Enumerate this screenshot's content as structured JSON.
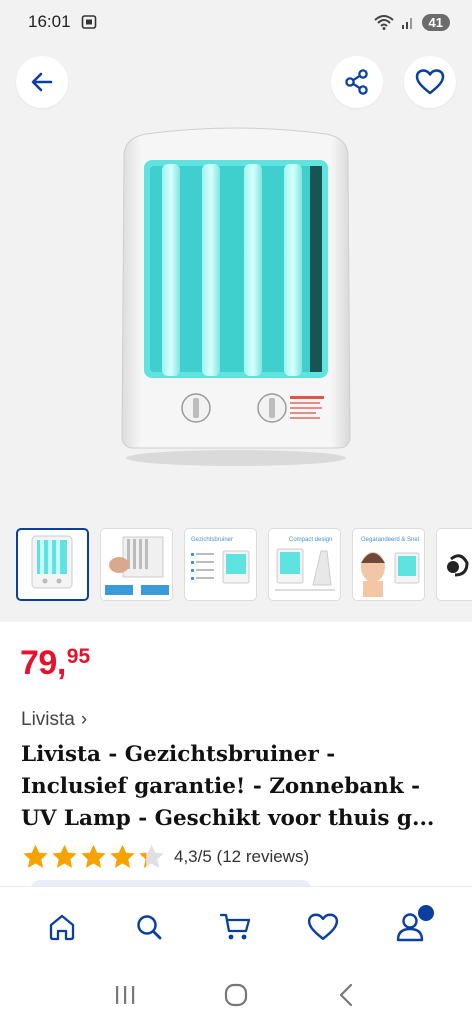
{
  "status_bar": {
    "time": "16:01",
    "battery": "41"
  },
  "gallery": {
    "thumbnails": [
      {
        "caption": ""
      },
      {
        "caption": ""
      },
      {
        "caption": "Gezichtsbruiner"
      },
      {
        "caption": "Compact design"
      },
      {
        "caption": "Gegarandeerd & Snel"
      },
      {
        "caption": ""
      }
    ]
  },
  "product": {
    "price_main": "79,",
    "price_cents": "95",
    "brand": "Livista",
    "brand_chevron": "›",
    "title_lines": [
      "Livista - Gezichtsbruiner -",
      "Inclusief garantie! - Zonnebank -",
      "UV Lamp - Geschikt voor thuis g..."
    ],
    "rating_value": 4.3,
    "rating_text": "4,3/5 (12 reviews)"
  },
  "colors": {
    "accent_blue": "#0a3fa0",
    "price_red": "#e8112d",
    "star_orange": "#f5a300",
    "lamp_cyan": "#5fe3e0"
  },
  "icons": {
    "back": "arrow-left-icon",
    "share": "share-icon",
    "favorite": "heart-icon",
    "nav": [
      "home-icon",
      "search-icon",
      "cart-icon",
      "heart-icon",
      "account-icon"
    ]
  }
}
